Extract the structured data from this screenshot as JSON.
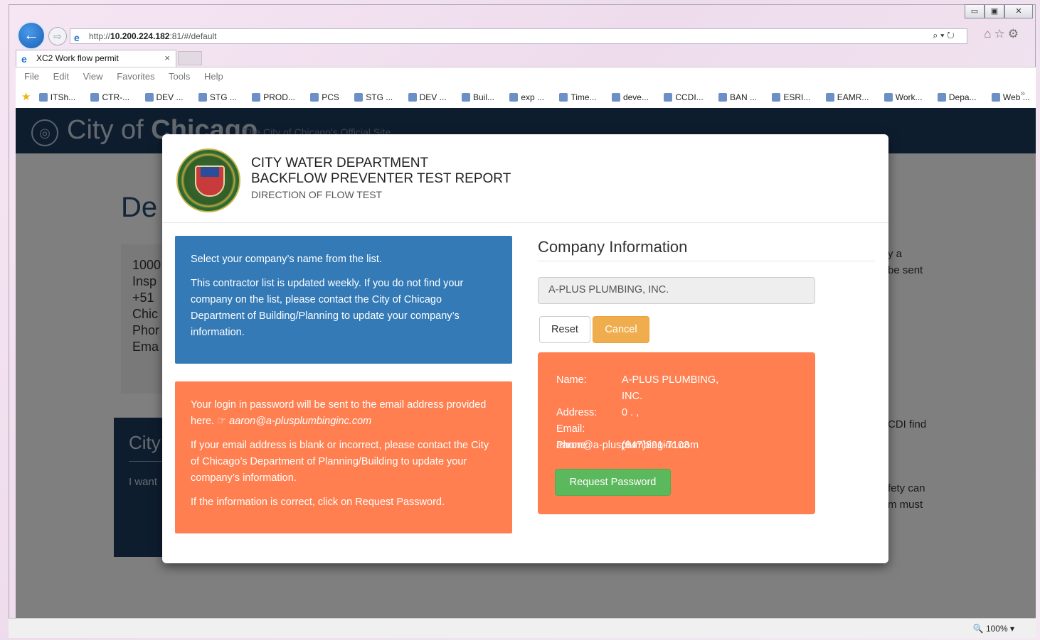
{
  "browser": {
    "url_prefix": "http://",
    "url_host": "10.200.224.182",
    "url_rest": ":81/#/default",
    "tab_title": "XC2 Work flow permit",
    "menu": [
      "File",
      "Edit",
      "View",
      "Favorites",
      "Tools",
      "Help"
    ],
    "favorites": [
      "ITSh...",
      "CTR-...",
      "DEV ...",
      "STG ...",
      "PROD...",
      "PCS",
      "STG ...",
      "DEV ...",
      "Buil...",
      "exp ...",
      "Time...",
      "deve...",
      "CCDI...",
      "BAN ...",
      "ESRI...",
      "EAMR...",
      "Work...",
      "Depa...",
      "Web ..."
    ],
    "zoom": "100%"
  },
  "site": {
    "title_a": "City of ",
    "title_b": "Chicago",
    "subtitle": "The City of Chicago's Official Site",
    "heading": "De",
    "address_lines": [
      "1000",
      "Insp",
      "+51",
      "Chic",
      "Phor",
      "Ema"
    ],
    "right_lines": [
      "y a",
      "be sent",
      "CDI find",
      "fety can",
      "m must"
    ],
    "city_heading": "City",
    "city_text": "I want"
  },
  "modal": {
    "title_line1": "CITY WATER DEPARTMENT",
    "title_line2": "BACKFLOW PREVENTER TEST REPORT",
    "subtitle": "DIRECTION OF FLOW TEST",
    "blue_p1": "Select your company’s name from the list.",
    "blue_p2": "This contractor list is updated weekly. If you do not find your company on the list, please contact the City of Chicago Department of Building/Planning to update your company’s information.",
    "orange_p1": "Your login in password will be sent to the email address provided here.",
    "orange_email": "aaron@a-plusplumbinginc.com",
    "orange_p2": "If your email address is blank or incorrect, please contact the City of Chicago’s Department of Planning/Building to update your company’s information.",
    "orange_p3": "If the information is correct, click on Request Password.",
    "company_heading": "Company Information",
    "company_value": "A-PLUS PLUMBING, INC.",
    "reset_label": "Reset",
    "cancel_label": "Cancel",
    "details": {
      "name_label": "Name:",
      "name_value": "A-PLUS PLUMBING, INC.",
      "address_label": "Address:",
      "address_value": "0 . ,",
      "email_label": "Email:",
      "email_value": "aaron@a-plusplumbinginc.com",
      "phone_label": "Phone:",
      "phone_value": "(847)891-7103"
    },
    "request_label": "Request Password"
  },
  "colors": {
    "primary": "#337ab7",
    "orange": "#ff7f50",
    "warning": "#f0ad4e",
    "success": "#5cb85c",
    "site_navy": "#1d3a5d"
  }
}
